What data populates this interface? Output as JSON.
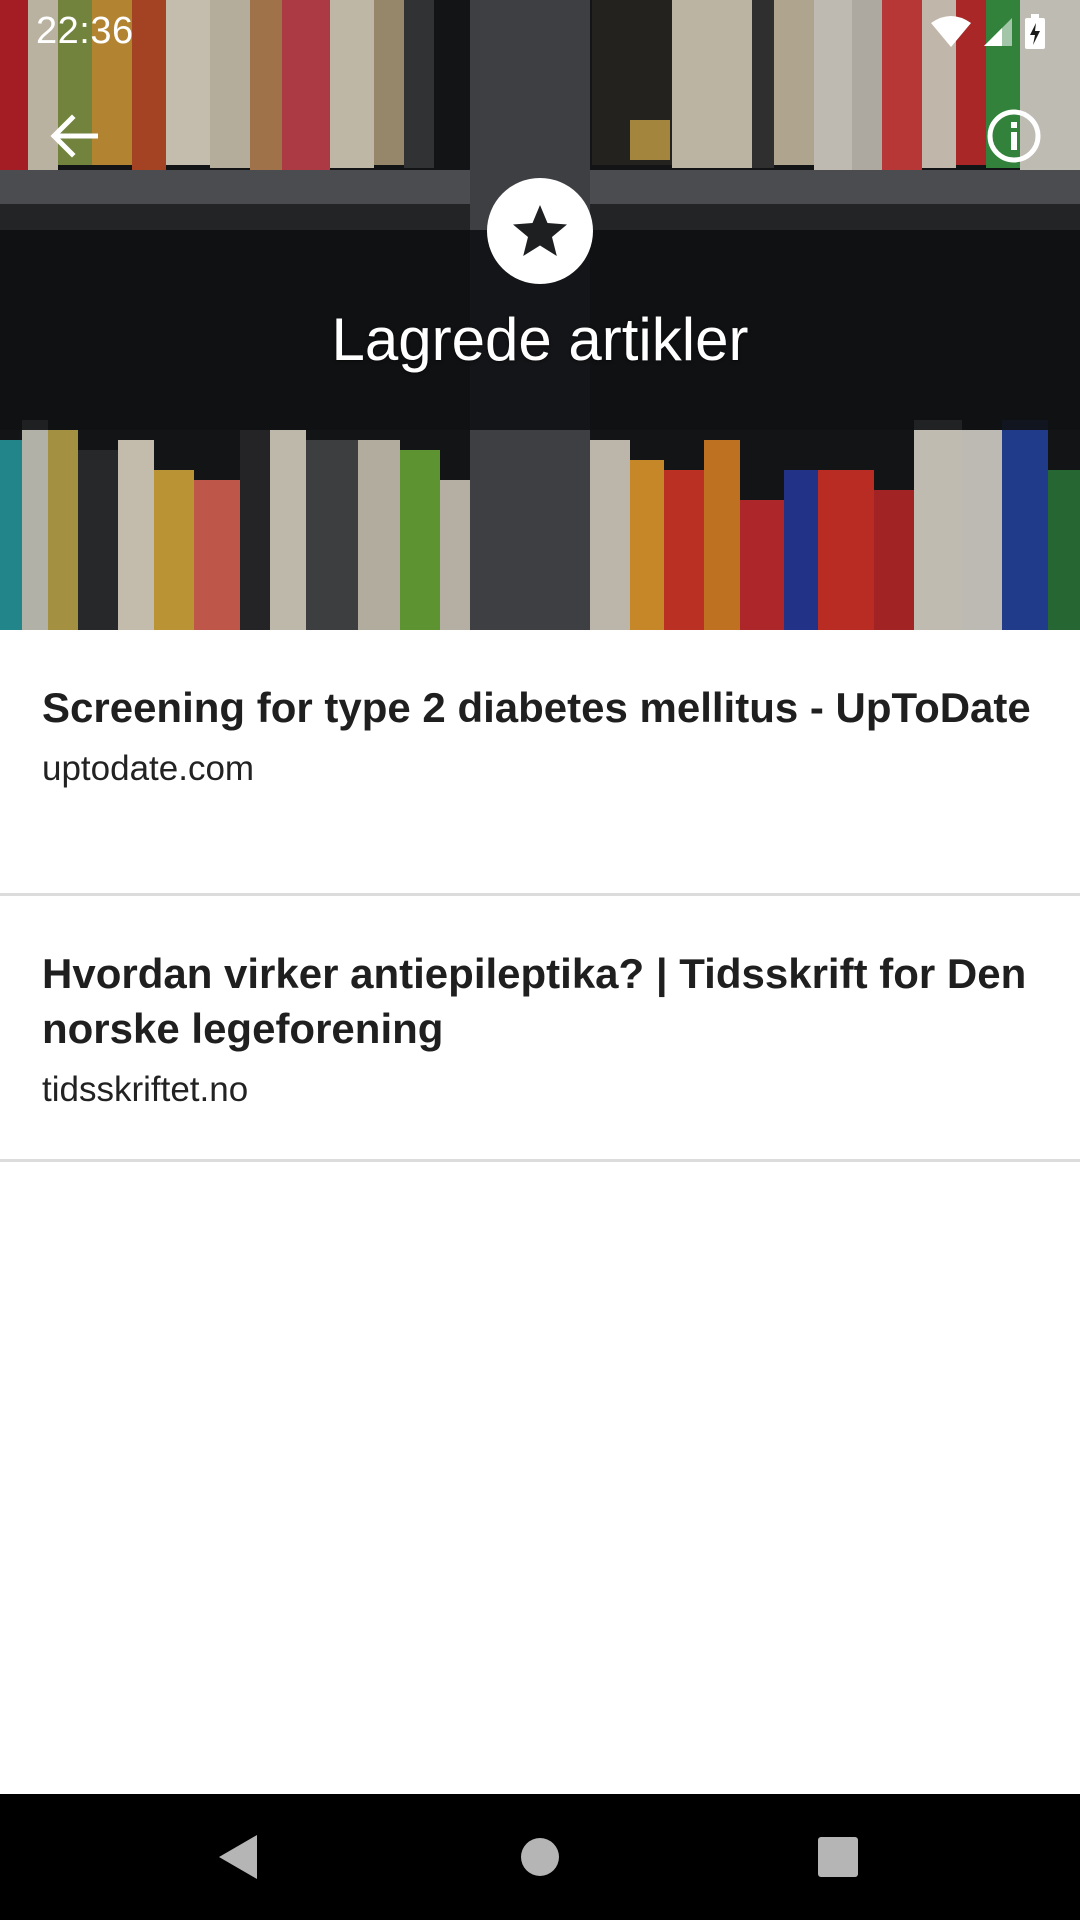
{
  "status_bar": {
    "time": "22:36",
    "icons": [
      "wifi-icon",
      "cell-signal-icon",
      "battery-charging-icon"
    ]
  },
  "app_bar": {
    "back_icon": "arrow-back-icon",
    "info_icon": "info-icon"
  },
  "header": {
    "badge_icon": "star-icon",
    "title": "Lagrede artikler"
  },
  "articles": [
    {
      "title": "Screening for type 2 diabetes mellitus - UpToDate",
      "source": "uptodate.com"
    },
    {
      "title": "Hvordan virker antiepileptika? | Tidsskrift for Den norske legeforening",
      "source": "tidsskriftet.no"
    }
  ],
  "nav_bar": {
    "buttons": [
      "nav-back-icon",
      "nav-home-icon",
      "nav-recents-icon"
    ]
  },
  "colors": {
    "title_text": "#1f1f1f",
    "divider": "#dcdcdc",
    "header_text": "#ffffff",
    "nav_background": "#000000"
  }
}
